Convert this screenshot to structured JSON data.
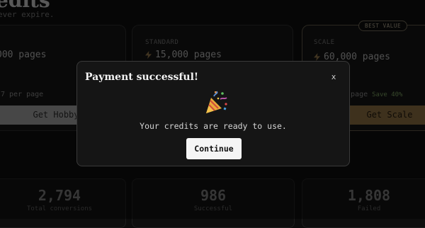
{
  "page": {
    "title": "edits",
    "subtitle": "ever expire."
  },
  "plans": [
    {
      "tier": "",
      "pages": "000 pages",
      "per_page": "7 per page",
      "button": "Get Hobby"
    },
    {
      "tier": "STANDARD",
      "pages": "15,000 pages",
      "per_page": "",
      "button": ""
    },
    {
      "tier": "SCALE",
      "pages": "60,000 pages",
      "per_page": "r page",
      "save": "Save 40%",
      "button": "Get Scale",
      "badge": "BEST VALUE"
    }
  ],
  "stats": [
    {
      "value": "2,794",
      "label": "Total conversions"
    },
    {
      "value": "986",
      "label": "Successful"
    },
    {
      "value": "1,808",
      "label": "Failed"
    }
  ],
  "modal": {
    "title": "Payment successful!",
    "close": "x",
    "icon": "party-popper-icon",
    "message": "Your credits are ready to use.",
    "button": "Continue"
  },
  "colors": {
    "background": "#0c0c0c",
    "modal_bg": "#151515",
    "scale_button": "#6b5532",
    "hobby_button": "#7a7a7a",
    "save_green": "#5e7a49"
  }
}
